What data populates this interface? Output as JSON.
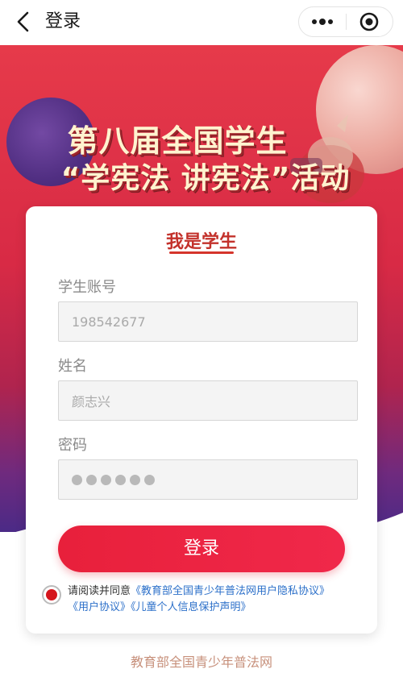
{
  "nav": {
    "title": "登录",
    "back_icon": "chevron-left-icon",
    "more_icon": "more-dots-icon",
    "close_icon": "target-close-icon"
  },
  "banner": {
    "line1": "第八届全国学生",
    "line2": "“学宪法 讲宪法”活动"
  },
  "card": {
    "title": "我是学生",
    "account_label": "学生账号",
    "account_value": "198542677",
    "name_label": "姓名",
    "name_value": "颜志兴",
    "password_label": "密码",
    "password_mask_count": 6,
    "login_label": "登录"
  },
  "agreement": {
    "prefix": "请阅读并同意",
    "privacy_link": "《教育部全国青少年普法网用户隐私协议》",
    "user_link": "《用户协议》",
    "child_link": "《儿童个人信息保护声明》",
    "checked": true
  },
  "footer": {
    "text": "教育部全国青少年普法网"
  },
  "colors": {
    "accent": "#e8203b",
    "title_red": "#c3312b",
    "link_blue": "#2b6fc9",
    "banner_red": "#e63a4a",
    "banner_purple": "#4b2a86"
  }
}
